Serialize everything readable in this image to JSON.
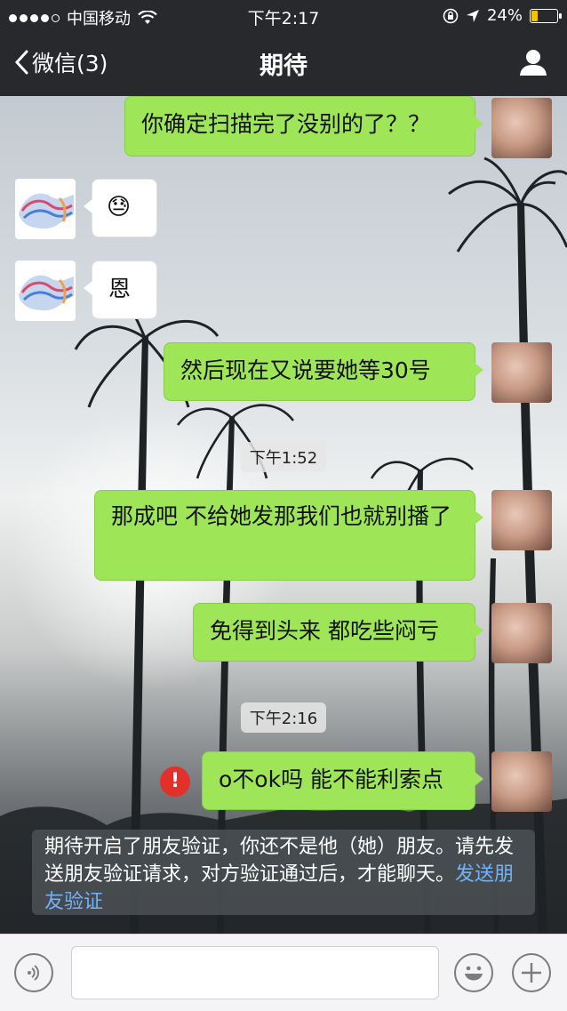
{
  "status_bar": {
    "carrier": "中国移动",
    "time": "下午2:17",
    "battery": "24%",
    "signal_bars": "4 of 5"
  },
  "nav": {
    "back_label": "微信(3)",
    "title": "期待"
  },
  "messages": [
    {
      "from": "me",
      "text": "你确定扫描完了没别的了？？"
    },
    {
      "from": "other",
      "text": "😓"
    },
    {
      "from": "other",
      "text": "恩"
    },
    {
      "from": "me",
      "text": "然后现在又说要她等30号"
    },
    {
      "timestamp": "下午1:52"
    },
    {
      "from": "me",
      "text": "那成吧 不给她发那我们也就别播了"
    },
    {
      "from": "me",
      "text": "免得到头来 都吃些闷亏"
    },
    {
      "timestamp": "下午2:16"
    },
    {
      "from": "me",
      "text": "o不ok吗 能不能利索点",
      "failed": true
    }
  ],
  "error_badge": "!",
  "notice": {
    "text": "期待开启了朋友验证，你还不是他（她）朋友。请先发送朋友验证请求，对方验证通过后，才能聊天。",
    "link": "发送朋友验证"
  },
  "colors": {
    "my_bubble": "#9ee658",
    "other_bubble": "#ffffff",
    "error": "#e2302a",
    "link": "#6fb3ff"
  },
  "icons": [
    "back-chevron-icon",
    "profile-icon",
    "voice-icon",
    "emoji-icon",
    "plus-icon",
    "wifi-icon",
    "location-icon",
    "lock-rotation-icon"
  ]
}
